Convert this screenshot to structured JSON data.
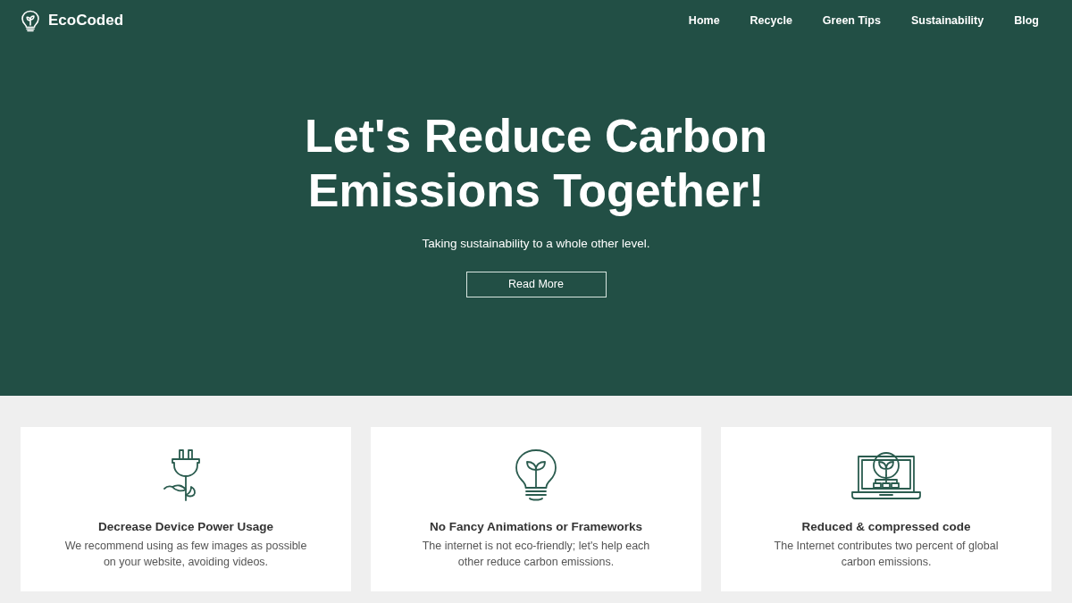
{
  "header": {
    "brand": "EcoCoded",
    "nav": [
      "Home",
      "Recycle",
      "Green Tips",
      "Sustainability",
      "Blog"
    ]
  },
  "hero": {
    "title": "Let's Reduce Carbon Emissions Together!",
    "subtitle": "Taking sustainability to a whole other level.",
    "button": "Read More"
  },
  "features": [
    {
      "title": "Decrease Device Power Usage",
      "description": "We recommend using as few images as possible on your website, avoiding videos."
    },
    {
      "title": "No Fancy Animations or Frameworks",
      "description": "The internet is not eco-friendly; let's help each other reduce carbon emissions."
    },
    {
      "title": "Reduced & compressed code",
      "description": "The Internet contributes two percent of global carbon emissions."
    }
  ]
}
